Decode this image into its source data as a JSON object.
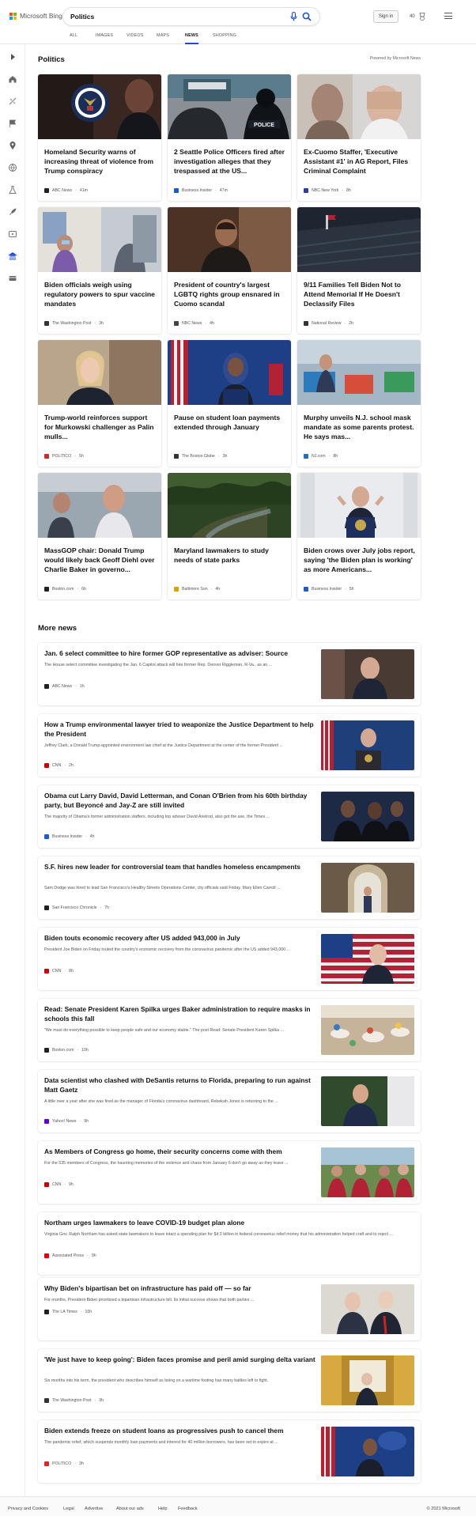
{
  "header": {
    "logo_text": "Microsoft Bing",
    "search_value": "Politics",
    "search_placeholder": "",
    "signin_label": "Sign in",
    "points": "40",
    "icons": [
      "microsoft-logo-icon",
      "mic-icon",
      "search-icon",
      "rewards-icon",
      "menu-icon"
    ],
    "colors": {
      "ms_red": "#f25022",
      "ms_green": "#7fba00",
      "ms_blue": "#00a4ef",
      "ms_yellow": "#ffb900",
      "accent": "#174ae4"
    }
  },
  "nav": {
    "tabs": [
      {
        "label": "ALL"
      },
      {
        "label": "IMAGES"
      },
      {
        "label": "VIDEOS"
      },
      {
        "label": "MAPS"
      },
      {
        "label": "NEWS",
        "active": true
      },
      {
        "label": "SHOPPING"
      }
    ]
  },
  "rail": {
    "icons": [
      "expand-icon",
      "home-icon",
      "sports-icon",
      "flag-icon",
      "location-icon",
      "globe-icon",
      "science-icon",
      "rocket-icon",
      "video-icon",
      "politics-icon",
      "money-icon"
    ]
  },
  "section": {
    "title": "Politics",
    "powered": "Powered by Microsoft News"
  },
  "cards": [
    {
      "title": "Homeland Security warns of increasing threat of violence from Trump conspiracy",
      "source": "ABC News",
      "time": "41m",
      "fav": "#222"
    },
    {
      "title": "2 Seattle Police Officers fired after investigation alleges that they trespassed at the US...",
      "source": "Business Insider",
      "time": "47m",
      "fav": "#1a5bd6"
    },
    {
      "title": "Ex-Cuomo Staffer, 'Executive Assistant #1' in AG Report, Files Criminal Complaint",
      "source": "NBC New York",
      "time": "8h",
      "fav": "#2b3ea8"
    },
    {
      "title": "Biden officials weigh using regulatory powers to spur vaccine mandates",
      "source": "The Washington Post",
      "time": "3h",
      "fav": "#333"
    },
    {
      "title": "President of country's largest LGBTQ rights group ensnared in Cuomo scandal",
      "source": "NBC News",
      "time": "4h",
      "fav": "#444"
    },
    {
      "title": "9/11 Families Tell Biden Not to Attend Memorial If He Doesn't Declassify Files",
      "source": "National Review",
      "time": "2h",
      "fav": "#333"
    },
    {
      "title": "Trump-world reinforces support for Murkowski challenger as Palin mulls...",
      "source": "POLITICO",
      "time": "5h",
      "fav": "#d62828"
    },
    {
      "title": "Pause on student loan payments extended through January",
      "source": "The Boston Globe",
      "time": "3h",
      "fav": "#333"
    },
    {
      "title": "Murphy unveils N.J. school mask mandate as some parents protest. He says mas...",
      "source": "NJ.com",
      "time": "8h",
      "fav": "#1d6fc2"
    },
    {
      "title": "MassGOP chair: Donald Trump would likely back Geoff Diehl over Charlie Baker in governo...",
      "source": "Boston.com",
      "time": "6h",
      "fav": "#222"
    },
    {
      "title": "Maryland lawmakers to study needs of state parks",
      "source": "Baltimore Sun",
      "time": "4h",
      "fav": "#e0a100"
    },
    {
      "title": "Biden crows over July jobs report, saying 'the Biden plan is working' as more Americans...",
      "source": "Business Insider",
      "time": "5h",
      "fav": "#1a5bd6"
    }
  ],
  "more_news": {
    "title": "More news",
    "items": [
      {
        "title": "Jan. 6 select committee to hire former GOP representative as adviser: Source",
        "snippet": "The House select committee investigating the Jan. 6 Capitol attack will hire former Rep. Denver Riggleman, R-Va., as an ...",
        "source": "ABC News",
        "time": "1h",
        "fav": "#222",
        "has_image": true
      },
      {
        "title": "How a Trump environmental lawyer tried to weaponize the Justice Department to help the President",
        "snippet": "Jeffrey Clark, a Donald Trump-appointed environment law chief at the Justice Department at the center of the former President ...",
        "source": "CNN",
        "time": "2h",
        "fav": "#cc0000",
        "has_image": true
      },
      {
        "title": "Obama cut Larry David, David Letterman, and Conan O'Brien from his 60th birthday party, but Beyoncé and Jay-Z are still invited",
        "snippet": "The majority of Obama's former administration staffers, including top adviser David Axelrod, also got the axe, the Times ...",
        "source": "Business Insider",
        "time": "4h",
        "fav": "#1a5bd6",
        "has_image": true
      },
      {
        "title": "S.F. hires new leader for controversial team that handles homeless encampments",
        "snippet": "Sam Dodge was hired to lead San Francisco's Healthy Streets Operations Center, city officials said Friday. Mary Ellen Carroll ...",
        "source": "San Francisco Chronicle",
        "time": "7h",
        "fav": "#222",
        "has_image": true
      },
      {
        "title": "Biden touts economic recovery after US added 943,000 in July",
        "snippet": "President Joe Biden on Friday touted the country's economic recovery from the coronavirus pandemic after the US added 943,000 ...",
        "source": "CNN",
        "time": "8h",
        "fav": "#cc0000",
        "has_image": true
      },
      {
        "title": "Read: Senate President Karen Spilka urges Baker administration to require masks in schools this fall",
        "snippet": "\"We must do everything possible to keep people safe and our economy stable.\" The post Read: Senate President Karen Spilka ...",
        "source": "Boston.com",
        "time": "10h",
        "fav": "#222",
        "has_image": true
      },
      {
        "title": "Data scientist who clashed with DeSantis returns to Florida, preparing to run against Matt Gaetz",
        "snippet": "A little over a year after she was fired as the manager of Florida's coronavirus dashboard, Rebekah Jones is returning to the ...",
        "source": "Yahoo! News",
        "time": "9h",
        "fav": "#6001d2",
        "has_image": true
      },
      {
        "title": "As Members of Congress go home, their security concerns come with them",
        "snippet": "For the 535 members of Congress, the haunting memories of the violence and chaos from January 6 don't go away as they leave ...",
        "source": "CNN",
        "time": "9h",
        "fav": "#cc0000",
        "has_image": true
      },
      {
        "title": "Northam urges lawmakers to leave COVID-19 budget plan alone",
        "snippet": "Virginia Gov. Ralph Northam has asked state lawmakers to leave intact a spending plan for $4.3 billion in federal coronavirus relief money that his administration helped craft and to reject ...",
        "source": "Associated Press",
        "time": "9h",
        "fav": "#e60000",
        "has_image": false
      },
      {
        "title": "Why Biden's bipartisan bet on infrastructure has paid off — so far",
        "snippet": "For months, President Biden prioritized a bipartisan infrastructure bill. Its initial success shows that both parties ...",
        "source": "The LA Times",
        "time": "10h",
        "fav": "#222",
        "has_image": true
      },
      {
        "title": "'We just have to keep going': Biden faces promise and peril amid surging delta variant",
        "snippet": "Six months into his term, the president who describes himself as being on a wartime footing has many battles left to fight.",
        "source": "The Washington Post",
        "time": "3h",
        "fav": "#333",
        "has_image": true
      },
      {
        "title": "Biden extends freeze on student loans as progressives push to cancel them",
        "snippet": "The pandemic relief, which suspends monthly loan payments and interest for 40 million borrowers, has been set to expire at ...",
        "source": "POLITICO",
        "time": "3h",
        "fav": "#d62828",
        "has_image": true
      }
    ]
  },
  "footer": {
    "links": [
      "Privacy and Cookies",
      "Legal",
      "Advertise",
      "About our ads",
      "Help",
      "Feedback"
    ],
    "copyright": "© 2021 Microsoft"
  }
}
